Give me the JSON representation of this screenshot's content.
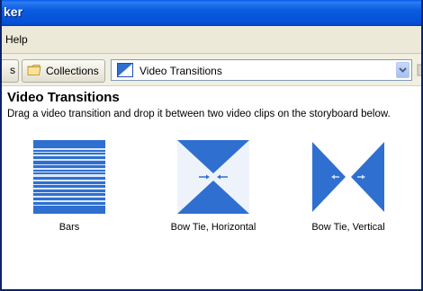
{
  "window": {
    "title": "ker"
  },
  "menu": {
    "help_label": "Help"
  },
  "toolbar": {
    "edge_label": "s",
    "collections_label": "Collections",
    "view_select": {
      "value": "Video Transitions"
    }
  },
  "content": {
    "heading": "Video Transitions",
    "description": "Drag a video transition and drop it between two video clips on the storyboard below.",
    "transitions": [
      {
        "label": "Bars",
        "icon": "bars-transition-icon"
      },
      {
        "label": "Bow Tie, Horizontal",
        "icon": "bow-tie-horizontal-icon"
      },
      {
        "label": "Bow Tie, Vertical",
        "icon": "bow-tie-vertical-icon"
      }
    ]
  },
  "colors": {
    "titlebar": "#0a5ae0",
    "thumb_blue": "#2f6fd0",
    "menubar": "#ece9d8"
  }
}
